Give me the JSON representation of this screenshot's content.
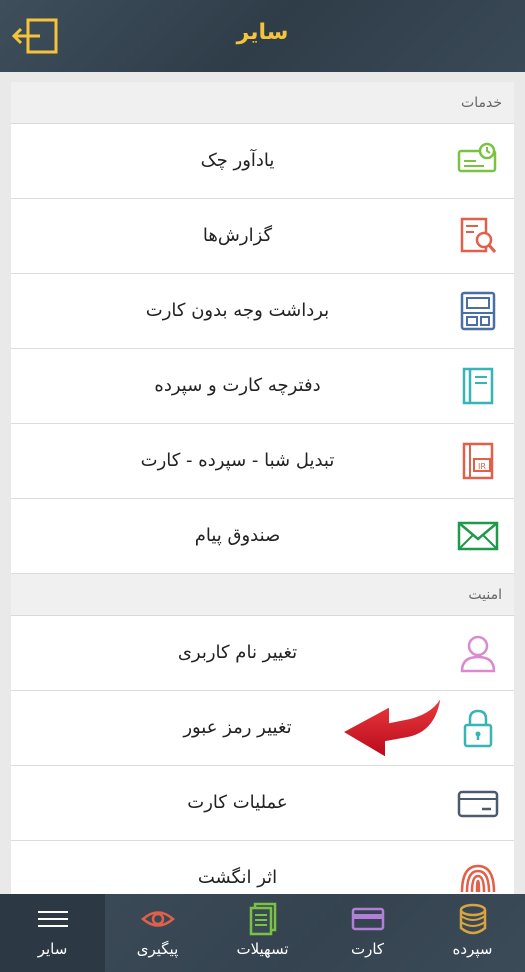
{
  "header": {
    "title": "سایر"
  },
  "sections": [
    {
      "title": "خدمات",
      "items": [
        {
          "label": "یادآور چک",
          "icon": "check-reminder-icon"
        },
        {
          "label": "گزارش‌ها",
          "icon": "report-search-icon"
        },
        {
          "label": "برداشت وجه بدون کارت",
          "icon": "atm-icon"
        },
        {
          "label": "دفترچه کارت و سپرده",
          "icon": "notebook-icon"
        },
        {
          "label": "تبدیل شبا - سپرده - کارت",
          "icon": "iban-ir-icon"
        },
        {
          "label": "صندوق پیام",
          "icon": "envelope-icon"
        }
      ]
    },
    {
      "title": "امنیت",
      "items": [
        {
          "label": "تغییر نام کاربری",
          "icon": "user-icon"
        },
        {
          "label": "تغییر رمز عبور",
          "icon": "lock-icon"
        },
        {
          "label": "عملیات کارت",
          "icon": "card-icon"
        },
        {
          "label": "اثر انگشت",
          "icon": "fingerprint-icon"
        }
      ]
    }
  ],
  "bottom_nav": [
    {
      "label": "سایر",
      "icon": "menu-icon",
      "active": true
    },
    {
      "label": "پیگیری",
      "icon": "eye-icon"
    },
    {
      "label": "تسهیلات",
      "icon": "document-icon"
    },
    {
      "label": "کارت",
      "icon": "card-icon"
    },
    {
      "label": "سپرده",
      "icon": "coins-icon"
    }
  ],
  "colors": {
    "header_bg": "#3b4a57",
    "title": "#f5c43a",
    "green": "#7cc242",
    "red": "#e2604a",
    "teal": "#35b5b5",
    "pink": "#d98ad1",
    "purple": "#b27fd6",
    "gold": "#d8a440",
    "arrow": "#d8142a"
  }
}
